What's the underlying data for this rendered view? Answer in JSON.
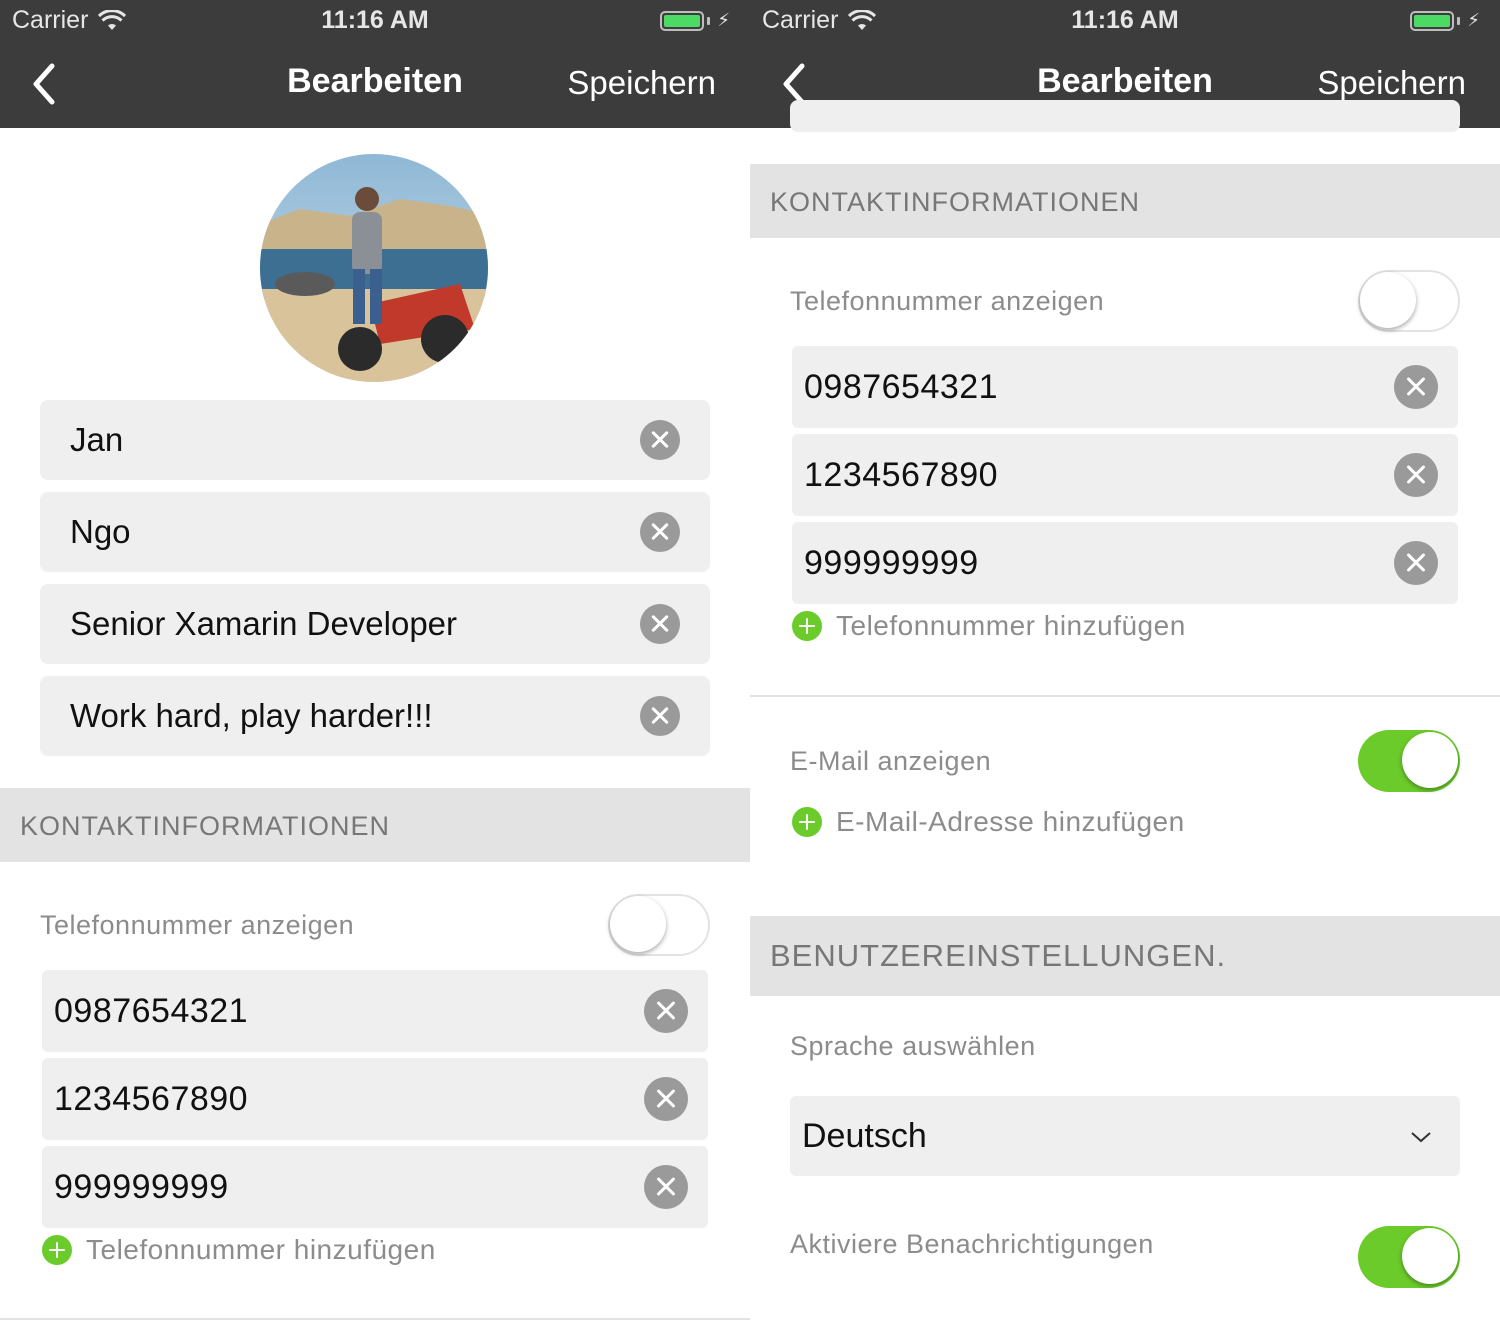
{
  "status": {
    "carrier": "Carrier",
    "time": "11:16 AM"
  },
  "nav": {
    "title": "Bearbeiten",
    "save": "Speichern"
  },
  "profile": {
    "first_name": "Jan",
    "last_name": "Ngo",
    "job_title": "Senior Xamarin Developer",
    "motto": "Work hard, play harder!!!"
  },
  "contact": {
    "section_title": "KONTAKTINFORMATIONEN",
    "show_phone_label": "Telefonnummer anzeigen",
    "show_phone": false,
    "phones": [
      "0987654321",
      "1234567890",
      "999999999"
    ],
    "add_phone": "Telefonnummer hinzufügen",
    "show_email_label": "E-Mail anzeigen",
    "show_email": true,
    "add_email": "E-Mail-Adresse hinzufügen"
  },
  "settings": {
    "section_title": "BENUTZEREINSTELLUNGEN.",
    "language_label": "Sprache auswählen",
    "language": "Deutsch",
    "notifications_label": "Aktiviere Benachrichtigungen",
    "notifications": true
  },
  "colors": {
    "navbar": "#3c3c3c",
    "accent_green": "#6bcb2a",
    "field_bg": "#efefef",
    "section_bg": "#e3e3e3"
  }
}
